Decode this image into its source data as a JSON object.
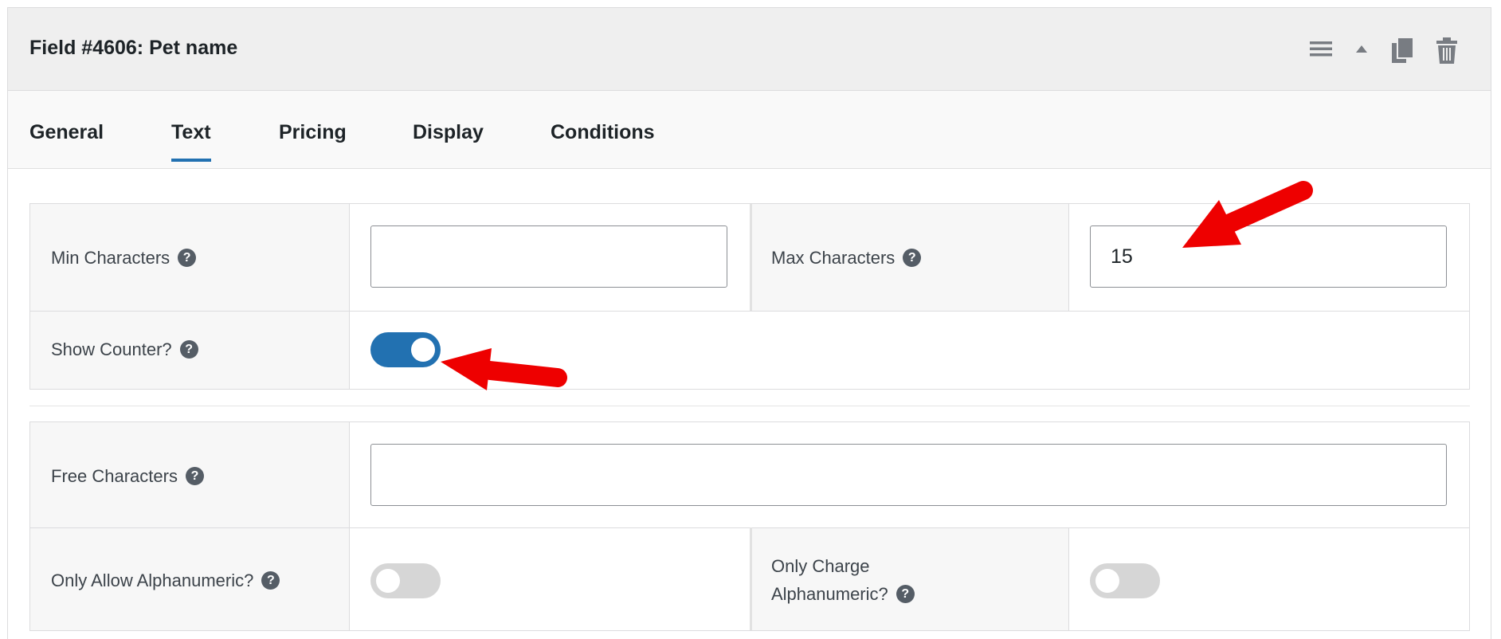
{
  "header": {
    "title": "Field #4606: Pet name",
    "icons": [
      "menu-icon",
      "collapse-up-icon",
      "duplicate-icon",
      "trash-icon"
    ]
  },
  "tabs": [
    {
      "label": "General",
      "active": false
    },
    {
      "label": "Text",
      "active": true
    },
    {
      "label": "Pricing",
      "active": false
    },
    {
      "label": "Display",
      "active": false
    },
    {
      "label": "Conditions",
      "active": false
    }
  ],
  "fields": {
    "min_characters": {
      "label": "Min Characters",
      "value": ""
    },
    "max_characters": {
      "label": "Max Characters",
      "value": "15"
    },
    "show_counter": {
      "label": "Show Counter?",
      "on": true
    },
    "free_characters": {
      "label": "Free Characters",
      "value": ""
    },
    "only_allow_alphanumeric": {
      "label": "Only Allow Alphanumeric?",
      "on": false
    },
    "only_charge_alphanumeric": {
      "label_line1": "Only Charge",
      "label_line2": "Alphanumeric?",
      "on": false
    }
  },
  "help_glyph": "?",
  "colors": {
    "accent": "#2271b1",
    "annotation_arrow": "#ee0000",
    "toggle_off": "#d6d6d6"
  }
}
